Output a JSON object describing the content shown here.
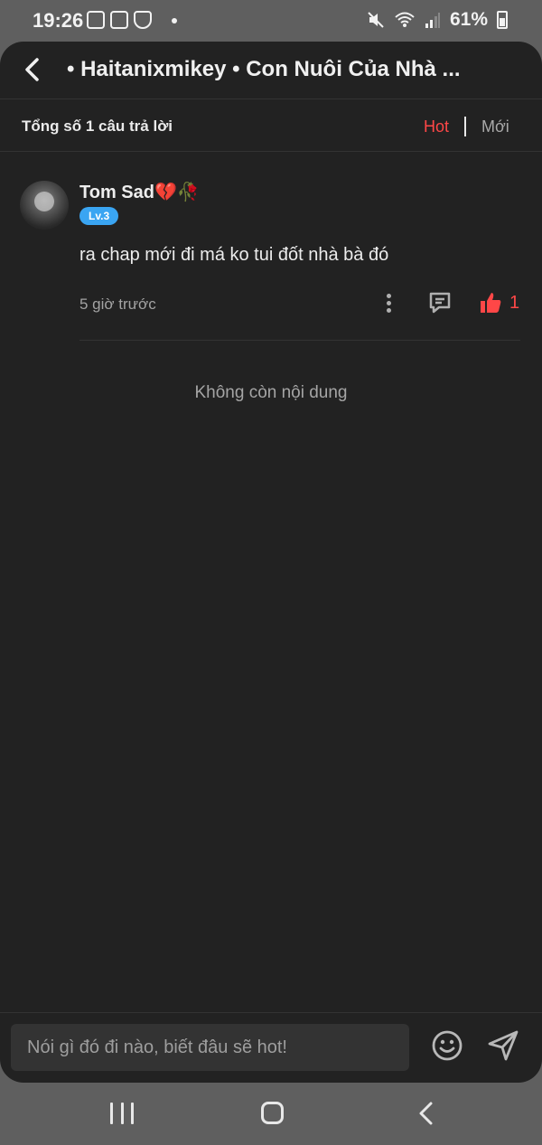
{
  "status_bar": {
    "time": "19:26",
    "battery": "61%",
    "icons": [
      "youtube-icon",
      "cast-icon",
      "shield-icon",
      "mute-icon",
      "wifi-icon",
      "signal-icon",
      "battery-icon"
    ]
  },
  "header": {
    "title": "• Haitanixmikey • Con Nuôi Của Nhà ..."
  },
  "subbar": {
    "total": "Tổng số 1 câu trả lời",
    "sort_hot": "Hot",
    "sort_new": "Mới"
  },
  "comment": {
    "username": "Tom Sad",
    "username_emoji": "💔🥀",
    "level": "Lv.3",
    "text": "ra chap mới đi má ko tui đốt nhà bà đó",
    "time": "5 giờ trước",
    "likes": "1"
  },
  "end_text": "Không còn nội dung",
  "composer": {
    "placeholder": "Nói gì đó đi nào, biết đâu sẽ hot!"
  },
  "colors": {
    "accent": "#ff4747",
    "level_badge": "#3aa5f2",
    "background": "#222222"
  }
}
